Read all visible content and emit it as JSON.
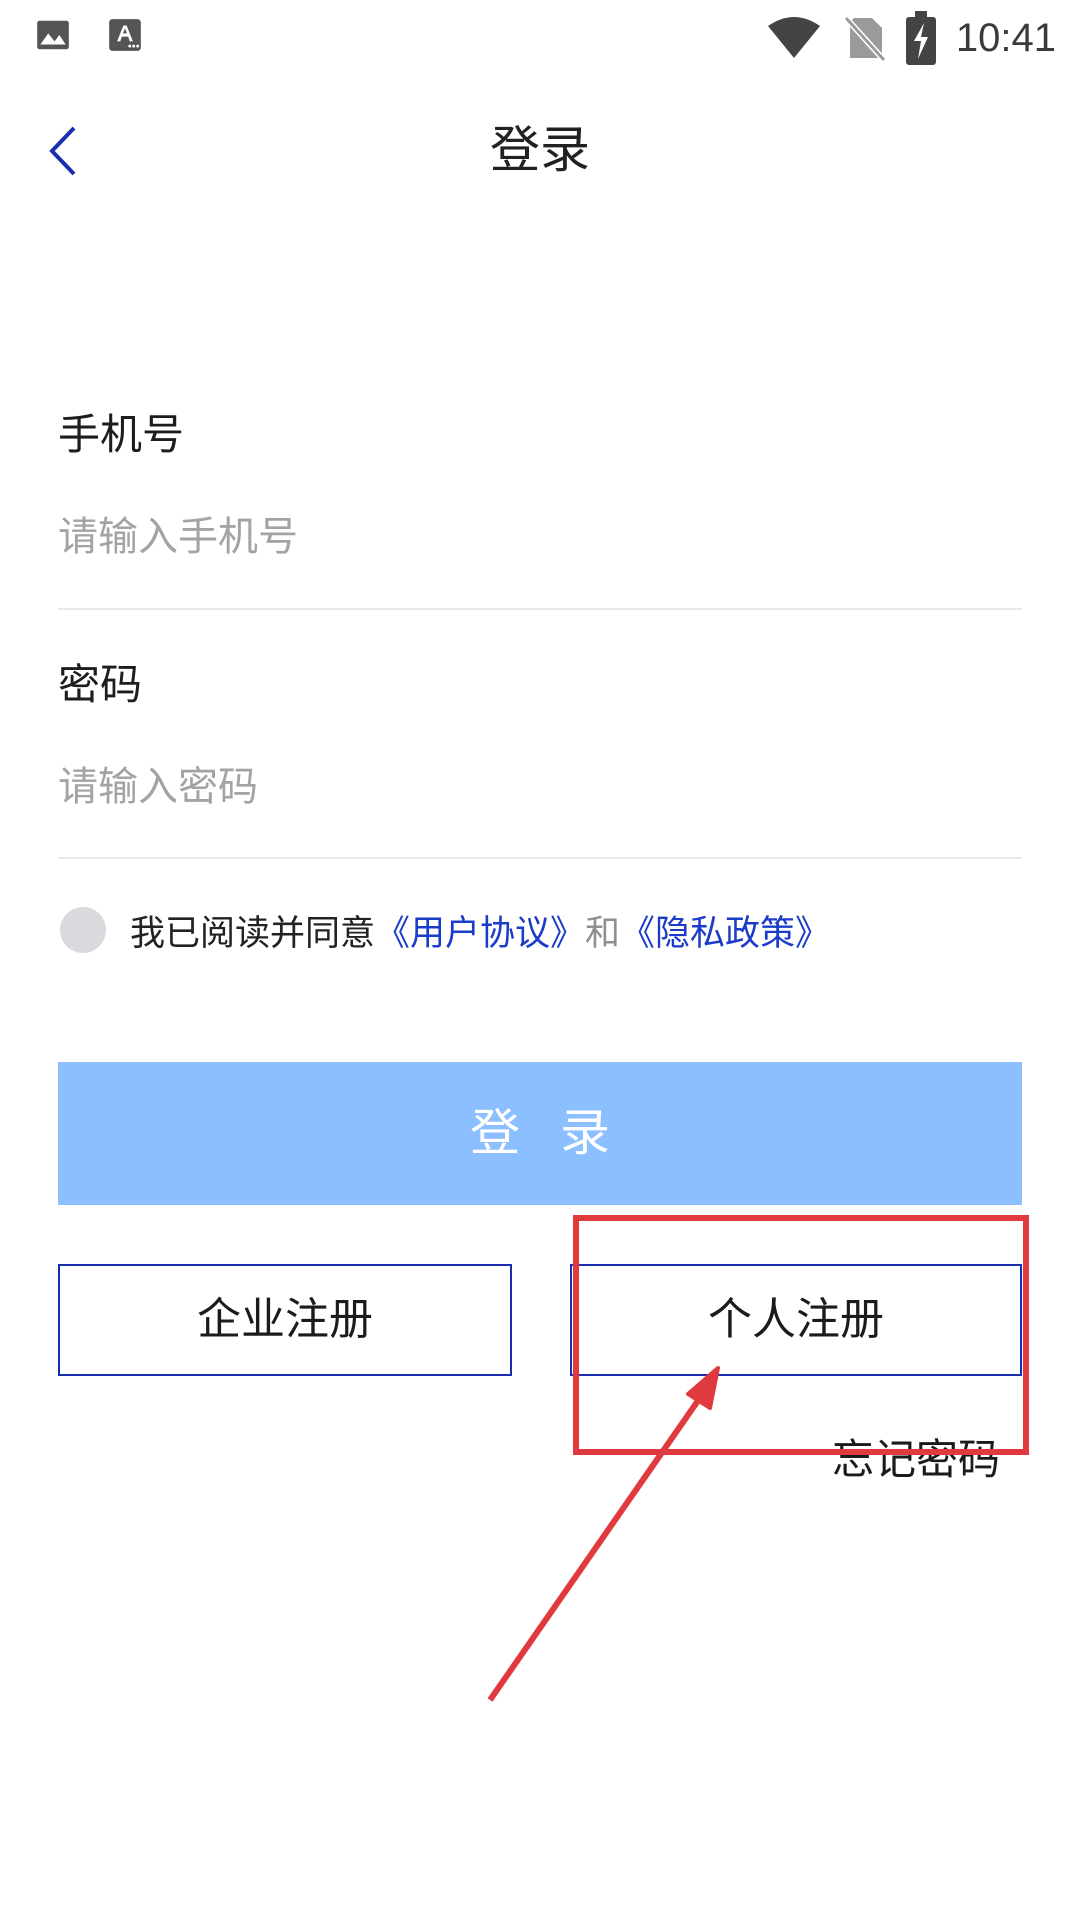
{
  "status_bar": {
    "time": "10:41",
    "left_icons": [
      "image-icon",
      "text-notification-icon"
    ],
    "right_icons": [
      "wifi-icon",
      "no-sim-icon",
      "battery-charging-icon"
    ]
  },
  "header": {
    "title": "登录",
    "back_icon": "chevron-left-icon",
    "back_color": "#1a2fb0"
  },
  "phone": {
    "label": "手机号",
    "placeholder": "请输入手机号",
    "value": ""
  },
  "password": {
    "label": "密码",
    "placeholder": "请输入密码",
    "value": ""
  },
  "agreement": {
    "checked": false,
    "prefix": "我已阅读并同意",
    "user_agreement": "《用户协议》",
    "and": "和",
    "privacy_policy": "《隐私政策》",
    "link_color": "#1a3cc8"
  },
  "login_button": {
    "label": "登录",
    "color": "#8bbfff"
  },
  "register": {
    "company_label": "企业注册",
    "personal_label": "个人注册",
    "border_color": "#1a2fb0"
  },
  "forgot_password": "忘记密码",
  "annotation": {
    "type": "highlight-box-with-arrow",
    "target": "个人注册",
    "color": "#e0393e"
  }
}
